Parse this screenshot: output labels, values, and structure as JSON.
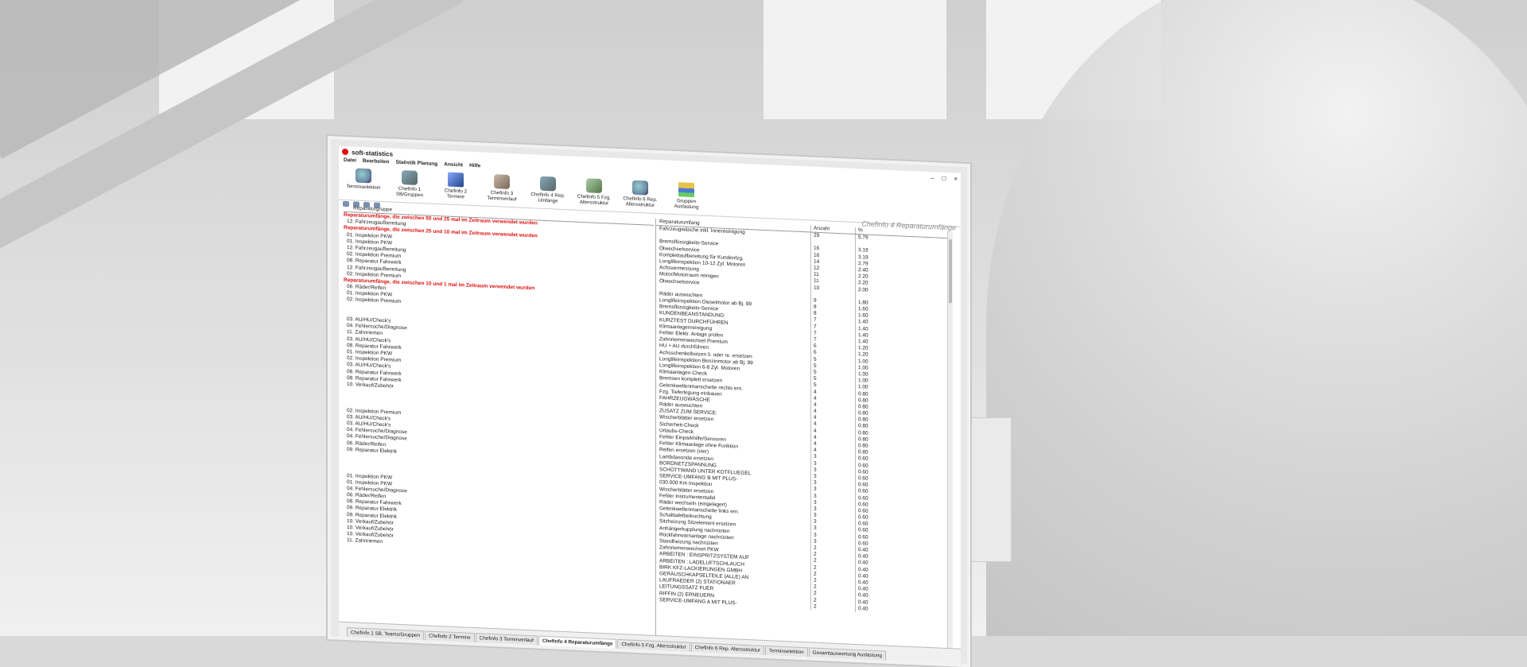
{
  "app": {
    "title": "soft-statistics",
    "window_controls": [
      "–",
      "□",
      "×"
    ]
  },
  "menu": [
    "Datei",
    "Bearbeiten",
    "Statistik Planung",
    "Ansicht",
    "Hilfe"
  ],
  "toolbar": [
    {
      "label": "Terminselektion",
      "icon": "calendar-search-icon"
    },
    {
      "label": "Chefinfo 1 SB/Gruppen",
      "icon": "people-clock-icon"
    },
    {
      "label": "Chefinfo 2 Termine",
      "icon": "clock-icon"
    },
    {
      "label": "Chefinfo 3 Terminverlauf",
      "icon": "people-icon"
    },
    {
      "label": "Chefinfo 4 Rep. Umfänge",
      "icon": "tools-icon"
    },
    {
      "label": "Chefinfo 5 Fzg. Altersstruktur",
      "icon": "car-icon"
    },
    {
      "label": "Chefinfo 6 Rep. Altersstruktur",
      "icon": "wrench-icon"
    },
    {
      "label": "Gruppen Auslastung",
      "icon": "bar-chart-icon"
    }
  ],
  "panel_title": "Chefinfo 4 Reparaturumfänge",
  "left": {
    "header": "Reparaturgruppe",
    "rows": [
      {
        "t": "Reparaturumfänge, die zwischen 50 und 25 mal im Zeitraum verwendet wurden",
        "red": true
      },
      {
        "t": "12. Fahrzeugaufbereitung"
      },
      {
        "t": "Reparaturumfänge, die zwischen 25 und 10 mal im Zeitraum verwendet wurden",
        "red": true
      },
      {
        "t": "01. Inspektion PKW"
      },
      {
        "t": "01. Inspektion PKW"
      },
      {
        "t": "12. Fahrzeugaufbereitung"
      },
      {
        "t": "02. Inspektion Premium"
      },
      {
        "t": "08. Reparatur Fahrwerk"
      },
      {
        "t": "12. Fahrzeugaufbereitung"
      },
      {
        "t": "02. Inspektion Premium"
      },
      {
        "t": "Reparaturumfänge, die zwischen 10 und 1 mal im Zeitraum verwendet wurden",
        "red": true
      },
      {
        "t": "06. Räder/Reifen"
      },
      {
        "t": "01. Inspektion PKW"
      },
      {
        "t": "02. Inspektion Premium"
      },
      {
        "t": ""
      },
      {
        "t": ""
      },
      {
        "t": "03. AU/HU/Check's"
      },
      {
        "t": "04. Fehlersuche/Diagnose"
      },
      {
        "t": "11. Zahnriemen"
      },
      {
        "t": "03. AU/HU/Check's"
      },
      {
        "t": "08. Reparatur Fahrwerk"
      },
      {
        "t": "01. Inspektion PKW"
      },
      {
        "t": "02. Inspektion Premium"
      },
      {
        "t": "03. AU/HU/Check's"
      },
      {
        "t": "08. Reparatur Fahrwerk"
      },
      {
        "t": "08. Reparatur Fahrwerk"
      },
      {
        "t": "10. Verkauf/Zubehör"
      },
      {
        "t": ""
      },
      {
        "t": ""
      },
      {
        "t": ""
      },
      {
        "t": "02. Inspektion Premium"
      },
      {
        "t": "03. AU/HU/Check's"
      },
      {
        "t": "03. AU/HU/Check's"
      },
      {
        "t": "04. Fehlersuche/Diagnose"
      },
      {
        "t": "04. Fehlersuche/Diagnose"
      },
      {
        "t": "06. Räder/Reifen"
      },
      {
        "t": "09. Reparatur Elektrik"
      },
      {
        "t": ""
      },
      {
        "t": ""
      },
      {
        "t": ""
      },
      {
        "t": "01. Inspektion PKW"
      },
      {
        "t": "01. Inspektion PKW"
      },
      {
        "t": "04. Fehlersuche/Diagnose"
      },
      {
        "t": "06. Räder/Reifen"
      },
      {
        "t": "08. Reparatur Fahrwerk"
      },
      {
        "t": "09. Reparatur Elektrik"
      },
      {
        "t": "09. Reparatur Elektrik"
      },
      {
        "t": "10. Verkauf/Zubehör"
      },
      {
        "t": "10. Verkauf/Zubehör"
      },
      {
        "t": "10. Verkauf/Zubehör"
      },
      {
        "t": "11. Zahnriemen"
      }
    ]
  },
  "right": {
    "headers": [
      "Reparaturumfang",
      "Anzahl",
      "%"
    ],
    "rows": [
      [
        "Fahrzeugwäsche inkl. Innenreinigung",
        "29",
        "5.79"
      ],
      [
        "",
        "",
        ""
      ],
      [
        "Bremsflüssigkeits-Service",
        "16",
        "3.19"
      ],
      [
        "Ölwechselservice",
        "16",
        "3.19"
      ],
      [
        "Komplettaufbereitung für Kundenfzg.",
        "14",
        "2.79"
      ],
      [
        "Longlifeinspektion 10-12 Zyl. Motoren",
        "12",
        "2.40"
      ],
      [
        "Achsvermessung",
        "11",
        "2.20"
      ],
      [
        "Motor/Motorraum reinigen",
        "11",
        "2.20"
      ],
      [
        "Ölwechselservice",
        "10",
        "2.00"
      ],
      [
        "",
        "",
        ""
      ],
      [
        "Räder auswuchten",
        "9",
        "1.80"
      ],
      [
        "Longlifeinspektion Dieselmotor ab Bj. 99",
        "8",
        "1.60"
      ],
      [
        "Bremsflüssigkeits-Service",
        "8",
        "1.60"
      ],
      [
        "KUNDENBEANSTANDUNG:",
        "7",
        "1.40"
      ],
      [
        "KURZTEST DURCHFÜHREN",
        "7",
        "1.40"
      ],
      [
        "Klimaanlagenreinigung",
        "7",
        "1.40"
      ],
      [
        "Fehler Elektr. Anlage prüfen",
        "7",
        "1.40"
      ],
      [
        "Zahnriemenwechsel Premium",
        "6",
        "1.20"
      ],
      [
        "HU + AU durchführen",
        "6",
        "1.20"
      ],
      [
        "Achsschenkelbolzen li. oder re. ersetzen",
        "5",
        "1.00"
      ],
      [
        "Longlifeinspektion Benzinmotor ab Bj. 99",
        "5",
        "1.00"
      ],
      [
        "Longlifeinspektion 6-8 Zyl. Motoren",
        "5",
        "1.00"
      ],
      [
        "Klimaanlagen-Check",
        "5",
        "1.00"
      ],
      [
        "Bremsen komplett ersetzen",
        "5",
        "1.00"
      ],
      [
        "Gelenkwellenmanschette rechts ern.",
        "4",
        "0.80"
      ],
      [
        "Fzg. Tieferlegung einbauen",
        "4",
        "0.80"
      ],
      [
        "FAHRZEUGWÄSCHE",
        "4",
        "0.80"
      ],
      [
        "Räder auswuchten",
        "4",
        "0.80"
      ],
      [
        "ZUSATZ ZUM SERVICE:",
        "4",
        "0.80"
      ],
      [
        "Wischerblätter ersetzen",
        "4",
        "0.80"
      ],
      [
        "Sicherheit-Check",
        "4",
        "0.80"
      ],
      [
        "Urlaubs-Check",
        "4",
        "0.80"
      ],
      [
        "Fehler Einparkhilfe/Sensoren",
        "4",
        "0.80"
      ],
      [
        "Fehler Klimaanlage ohne Funktion",
        "4",
        "0.80"
      ],
      [
        "Reifen ersetzen (vier)",
        "3",
        "0.60"
      ],
      [
        "Lambdasonde ersetzen",
        "3",
        "0.60"
      ],
      [
        "BORDNETZSPANNUNG",
        "3",
        "0.60"
      ],
      [
        "SCHOTTWAND UNTER KOTFLUEGEL",
        "3",
        "0.60"
      ],
      [
        "SERVICE-UMFANG B MIT PLUS-",
        "3",
        "0.60"
      ],
      [
        "030.000 Km Inspektion",
        "3",
        "0.60"
      ],
      [
        "Wischerblätter ersetzen",
        "3",
        "0.60"
      ],
      [
        "Fehler Instrumententafel",
        "3",
        "0.60"
      ],
      [
        "Räder wechseln (eingelagert)",
        "3",
        "0.60"
      ],
      [
        "Gelenkwellenmanschette links ern.",
        "3",
        "0.60"
      ],
      [
        "Schalttafelbeleuchtung",
        "3",
        "0.60"
      ],
      [
        "Sitzheizung Sitzelement ersetzen",
        "3",
        "0.60"
      ],
      [
        "Anhängerkupplung nachrüsten",
        "3",
        "0.60"
      ],
      [
        "Rückfahrwarnanlage nachrüsten",
        "3",
        "0.60"
      ],
      [
        "Standheizung nachrüsten",
        "2",
        "0.40"
      ],
      [
        "Zahnriemenwechsel PKW",
        "2",
        "0.40"
      ],
      [
        "ARBEITEN : EINSPRITZSYSTEM AUF",
        "2",
        "0.40"
      ],
      [
        "ARBEITEN : LADELUFTSCHLAUCH",
        "2",
        "0.40"
      ],
      [
        "BIRK KFZ-LACKIERUNGEN GMBH",
        "2",
        "0.40"
      ],
      [
        "GERÄUSCHKAPSELTEILE (ALLE) AN",
        "2",
        "0.40"
      ],
      [
        "LAUFRAEDER (2) STATIONAER",
        "2",
        "0.40"
      ],
      [
        "LEITUNGSSATZ FUER",
        "2",
        "0.40"
      ],
      [
        "RIFFIN (2) ERNEUERN",
        "2",
        "0.40"
      ],
      [
        "SERVICE-UMFANG A MIT PLUS-",
        "2",
        "0.40"
      ]
    ]
  },
  "tabs": [
    {
      "label": "Chefinfo 1 SB, Teams/Gruppen",
      "active": false
    },
    {
      "label": "Chefinfo 2 Termine",
      "active": false
    },
    {
      "label": "Chefinfo 3 Terminverlauf",
      "active": false
    },
    {
      "label": "Chefinfo 4 Reparaturumfänge",
      "active": true
    },
    {
      "label": "Chefinfo 5 Fzg. Altersstruktur",
      "active": false
    },
    {
      "label": "Chefinfo 6 Rep. Altersstruktur",
      "active": false
    },
    {
      "label": "Terminselektion",
      "active": false
    },
    {
      "label": "Gesamtauswertung Auslastung",
      "active": false
    }
  ]
}
